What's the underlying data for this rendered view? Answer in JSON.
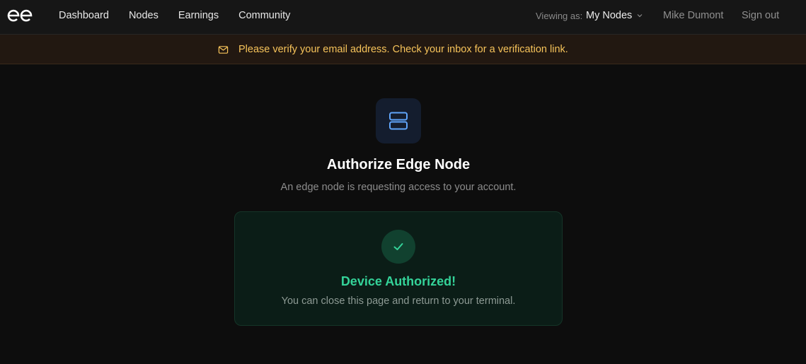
{
  "nav": {
    "items": [
      {
        "label": "Dashboard"
      },
      {
        "label": "Nodes"
      },
      {
        "label": "Earnings"
      },
      {
        "label": "Community"
      }
    ]
  },
  "header": {
    "viewing_label": "Viewing as:",
    "viewing_value": "My Nodes",
    "user_name": "Mike Dumont",
    "sign_out": "Sign out"
  },
  "banner": {
    "icon": "mail-icon",
    "text": "Please verify your email address. Check your inbox for a verification link."
  },
  "main": {
    "icon": "server-icon",
    "title": "Authorize Edge Node",
    "subtitle": "An edge node is requesting access to your account."
  },
  "status_card": {
    "icon": "check-icon",
    "title": "Device Authorized!",
    "text": "You can close this page and return to your terminal."
  },
  "colors": {
    "accent_green": "#34d399",
    "accent_blue": "#60a5fa",
    "warning_text": "#f6c35a"
  }
}
